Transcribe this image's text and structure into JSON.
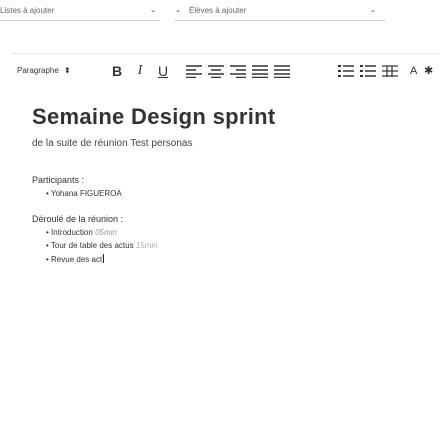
{
  "topbar": {
    "list_select_value": "Listes à ajouter",
    "students_select_value": "Élèves à ajouter"
  },
  "toolbar": {
    "paragraph_style": "Paragraphe",
    "bold": "B",
    "italic": "I",
    "underline": "U"
  },
  "document": {
    "title": "Semaine Design sprint",
    "subtitle": "de la suite de réunion Test personas",
    "participants_label": "Participants",
    "participants_colon": ":",
    "participants": [
      "• Yohana FIGUEROA"
    ],
    "agenda_label": "Déroulé de la réunion",
    "agenda_colon": ":",
    "agenda_items": [
      {
        "text": "• Introduction",
        "duration": "05min"
      },
      {
        "text": "• Tour de table des actus",
        "duration": "15min"
      },
      {
        "text": "• Revue des act",
        "duration": ""
      }
    ]
  }
}
